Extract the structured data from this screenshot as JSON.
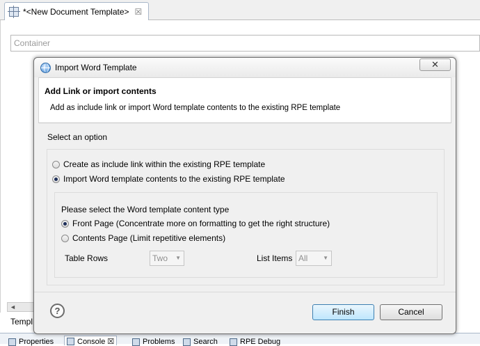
{
  "editor": {
    "tab_title": "*<New Document Template>",
    "tab_close": "☒",
    "container_placeholder": "Container",
    "templ_label": "Templ",
    "scroll_left": "◄"
  },
  "bottom_tabs": [
    {
      "label": "Properties"
    },
    {
      "label": "Console ☒"
    },
    {
      "label": "Problems"
    },
    {
      "label": "Search"
    },
    {
      "label": "RPE Debug"
    }
  ],
  "dialog": {
    "title": "Import Word Template",
    "close_glyph": "✕",
    "heading": "Add Link or import contents",
    "description": "Add as include link or import Word template contents to the existing RPE template",
    "select_label": "Select an option",
    "options": [
      {
        "label": "Create as include link within the existing RPE template",
        "checked": false
      },
      {
        "label": "Import Word template contents to the existing RPE template",
        "checked": true
      }
    ],
    "content_type_label": "Please select the Word template content type",
    "content_types": [
      {
        "label": "Front Page (Concentrate more on formatting to get the right structure)",
        "checked": true
      },
      {
        "label": "Contents Page (Limit repetitive elements)",
        "checked": false
      }
    ],
    "table_rows_label": "Table Rows",
    "table_rows_value": "Two",
    "list_items_label": "List Items",
    "list_items_value": "All",
    "help_glyph": "?",
    "finish_label": "Finish",
    "cancel_label": "Cancel"
  }
}
